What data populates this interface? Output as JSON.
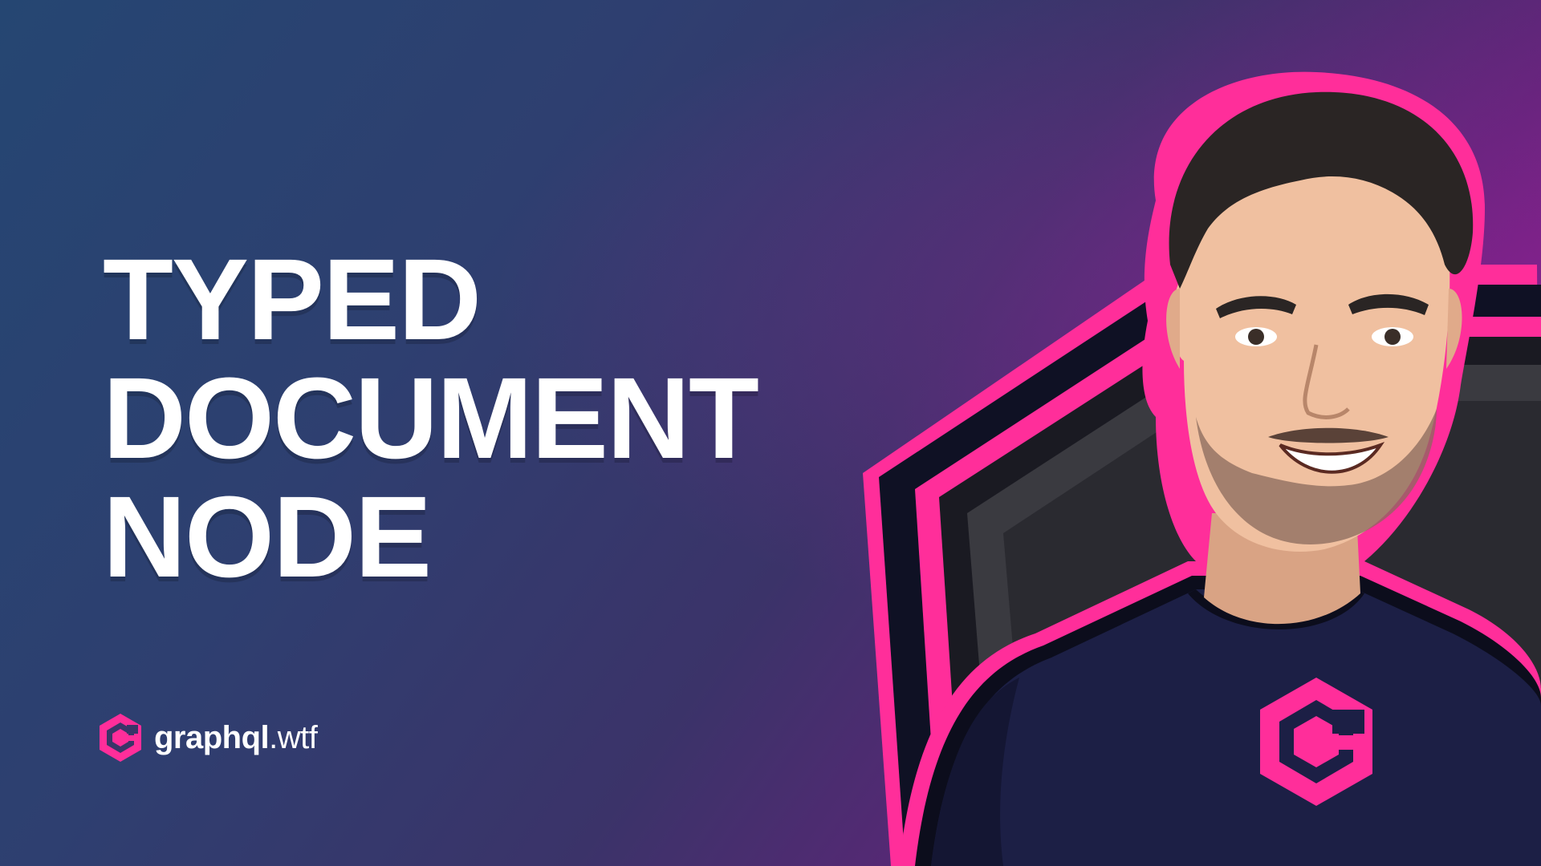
{
  "title": {
    "line1": "TYPED",
    "line2": "DOCUMENT",
    "line3": "NODE"
  },
  "brand": {
    "name_bold": "graphql",
    "name_light": ".wtf",
    "logo_icon": "hexagon-g-logo-icon"
  },
  "colors": {
    "accent_pink": "#ff2e9a",
    "shirt_navy": "#1c1f45",
    "text": "#ffffff"
  },
  "illustration": {
    "subject": "avatar-illustration",
    "badge_icon": "hexagon-g-logo-icon"
  }
}
